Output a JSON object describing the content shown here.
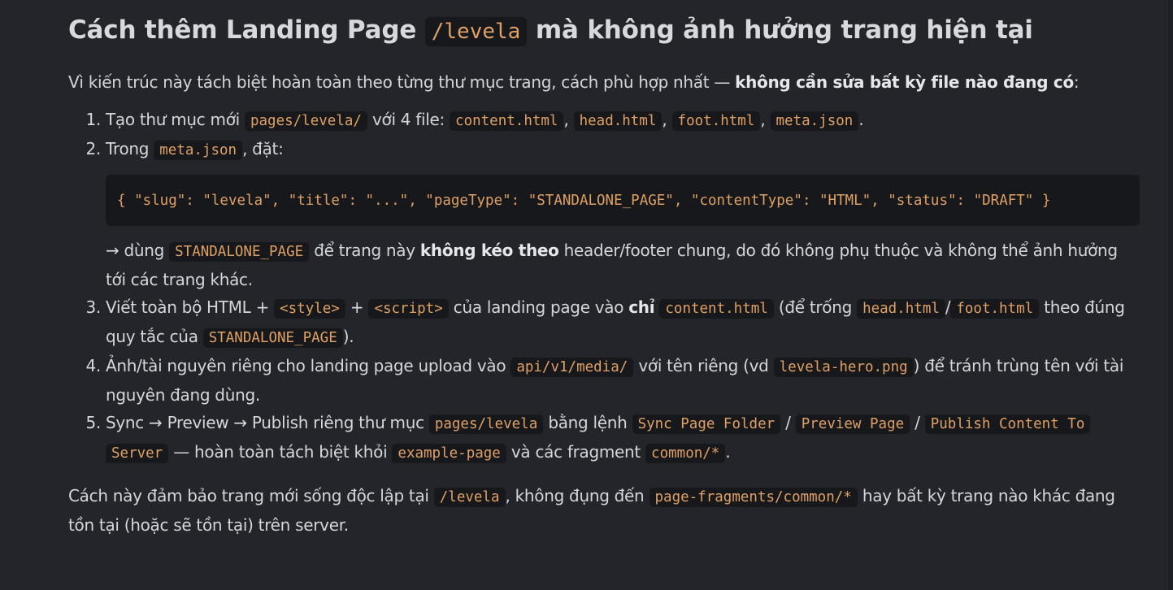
{
  "heading": {
    "before": "Cách thêm Landing Page ",
    "code": "/levela",
    "after": " mà không ảnh hưởng trang hiện tại"
  },
  "intro": {
    "text": "Vì kiến trúc này tách biệt hoàn toàn theo từng thư mục trang, cách phù hợp nhất — ",
    "bold": "không cần sửa bất kỳ file nào đang có",
    "end": ":"
  },
  "steps": {
    "s1": {
      "t1": "Tạo thư mục mới ",
      "c1": "pages/levela/",
      "t2": " với 4 file: ",
      "c2": "content.html",
      "t3": ", ",
      "c3": "head.html",
      "t4": ", ",
      "c4": "foot.html",
      "t5": ", ",
      "c5": "meta.json",
      "t6": "."
    },
    "s2": {
      "t1": "Trong ",
      "c1": "meta.json",
      "t2": ", đặt:",
      "code_block": "{ \"slug\": \"levela\", \"title\": \"...\", \"pageType\": \"STANDALONE_PAGE\", \"contentType\": \"HTML\", \"status\": \"DRAFT\" }",
      "n1": "→ dùng ",
      "nc1": "STANDALONE_PAGE",
      "n2": " để trang này ",
      "nb": "không kéo theo",
      "n3": " header/footer chung, do đó không phụ thuộc và không thể ảnh hưởng tới các trang khác."
    },
    "s3": {
      "t1": "Viết toàn bộ HTML + ",
      "c1": "<style>",
      "t2": " + ",
      "c2": "<script>",
      "t3": " của landing page vào ",
      "b1": "chỉ",
      "t4": " ",
      "c3": "content.html",
      "t5": " (để trống ",
      "c4": "head.html",
      "t6": "/",
      "c5": "foot.html",
      "t7": " theo đúng quy tắc của ",
      "c6": "STANDALONE_PAGE",
      "t8": ")."
    },
    "s4": {
      "t1": "Ảnh/tài nguyên riêng cho landing page upload vào ",
      "c1": "api/v1/media/",
      "t2": " với tên riêng (vd ",
      "c2": "levela-hero.png",
      "t3": ") để tránh trùng tên với tài nguyên đang dùng."
    },
    "s5": {
      "t1": "Sync → Preview → Publish riêng thư mục ",
      "c1": "pages/levela",
      "t2": " bằng lệnh ",
      "c2": "Sync Page Folder",
      "t3": " / ",
      "c3": "Preview Page",
      "t4": " / ",
      "c4": "Publish Content To",
      "t4b": " ",
      "c4b": "Server",
      "t5": " — hoàn toàn tách biệt khỏi ",
      "c5": "example-page",
      "t6": " và các fragment ",
      "c6": "common/*",
      "t7": "."
    }
  },
  "outro": {
    "t1": "Cách này đảm bảo trang mới sống độc lập tại ",
    "c1": "/levela",
    "t2": ", không đụng đến ",
    "c2": "page-fragments/common/*",
    "t3": " hay bất kỳ trang nào khác đang tồn tại (hoặc sẽ tồn tại) trên server."
  }
}
